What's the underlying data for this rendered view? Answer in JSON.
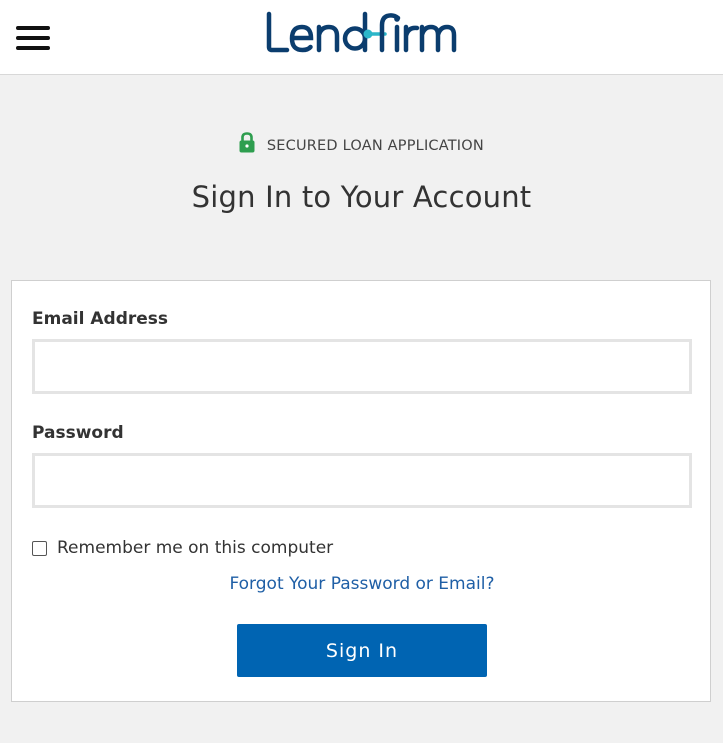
{
  "header": {
    "menu_icon": "hamburger-menu-icon",
    "logo_text": "LendFirm",
    "logo_colors": {
      "primary": "#0b3d6e",
      "accent": "#2bb6c9"
    }
  },
  "secure_banner": {
    "icon": "lock-icon",
    "icon_color": "#2e9e4f",
    "text": "SECURED LOAN APPLICATION"
  },
  "page_title": "Sign In to Your Account",
  "form": {
    "email": {
      "label": "Email Address",
      "value": "",
      "placeholder": ""
    },
    "password": {
      "label": "Password",
      "value": "",
      "placeholder": ""
    },
    "remember": {
      "label": "Remember me on this computer",
      "checked": false
    },
    "forgot_link": "Forgot Your Password or Email?",
    "submit_label": "Sign In"
  },
  "colors": {
    "page_background": "#f1f1f1",
    "button": "#0064b2",
    "link": "#1f5fa6"
  }
}
